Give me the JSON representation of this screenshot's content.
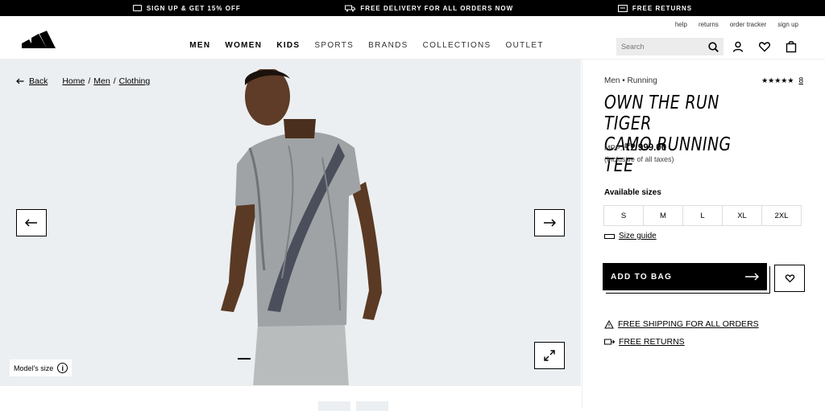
{
  "promo": {
    "items": [
      {
        "label": "SIGN UP & GET 15% OFF",
        "icon": "card-icon"
      },
      {
        "label": "FREE DELIVERY FOR ALL ORDERS NOW",
        "icon": "truck-icon"
      },
      {
        "label": "FREE RETURNS",
        "icon": "return-icon"
      }
    ]
  },
  "header": {
    "util_links": [
      "help",
      "returns",
      "order tracker",
      "sign up"
    ],
    "nav": [
      "MEN",
      "WOMEN",
      "KIDS",
      "SPORTS",
      "BRANDS",
      "COLLECTIONS",
      "OUTLET"
    ],
    "search_placeholder": "Search"
  },
  "breadcrumb": {
    "back": "Back",
    "items": [
      "Home",
      "Men",
      "Clothing"
    ],
    "sep": "/"
  },
  "gallery": {
    "model_size": "Model's size",
    "info": "i"
  },
  "product": {
    "category": "Men • Running",
    "stars": "★★★★★",
    "review_count": "8",
    "title_line1": "OWN THE RUN TIGER",
    "title_line2": "CAMO RUNNING TEE",
    "mrp_label": "MRP:",
    "price": "₹2 999.00",
    "tax_note": "(Inclusive of all taxes)",
    "sizes_label": "Available sizes",
    "sizes": [
      "S",
      "M",
      "L",
      "XL",
      "2XL"
    ],
    "size_guide": "Size guide",
    "add_to_bag": "ADD TO BAG",
    "benefits": [
      "FREE SHIPPING FOR ALL ORDERS",
      "FREE RETURNS"
    ]
  },
  "colors": {
    "black": "#000000",
    "gallery_bg": "#eceff1"
  }
}
